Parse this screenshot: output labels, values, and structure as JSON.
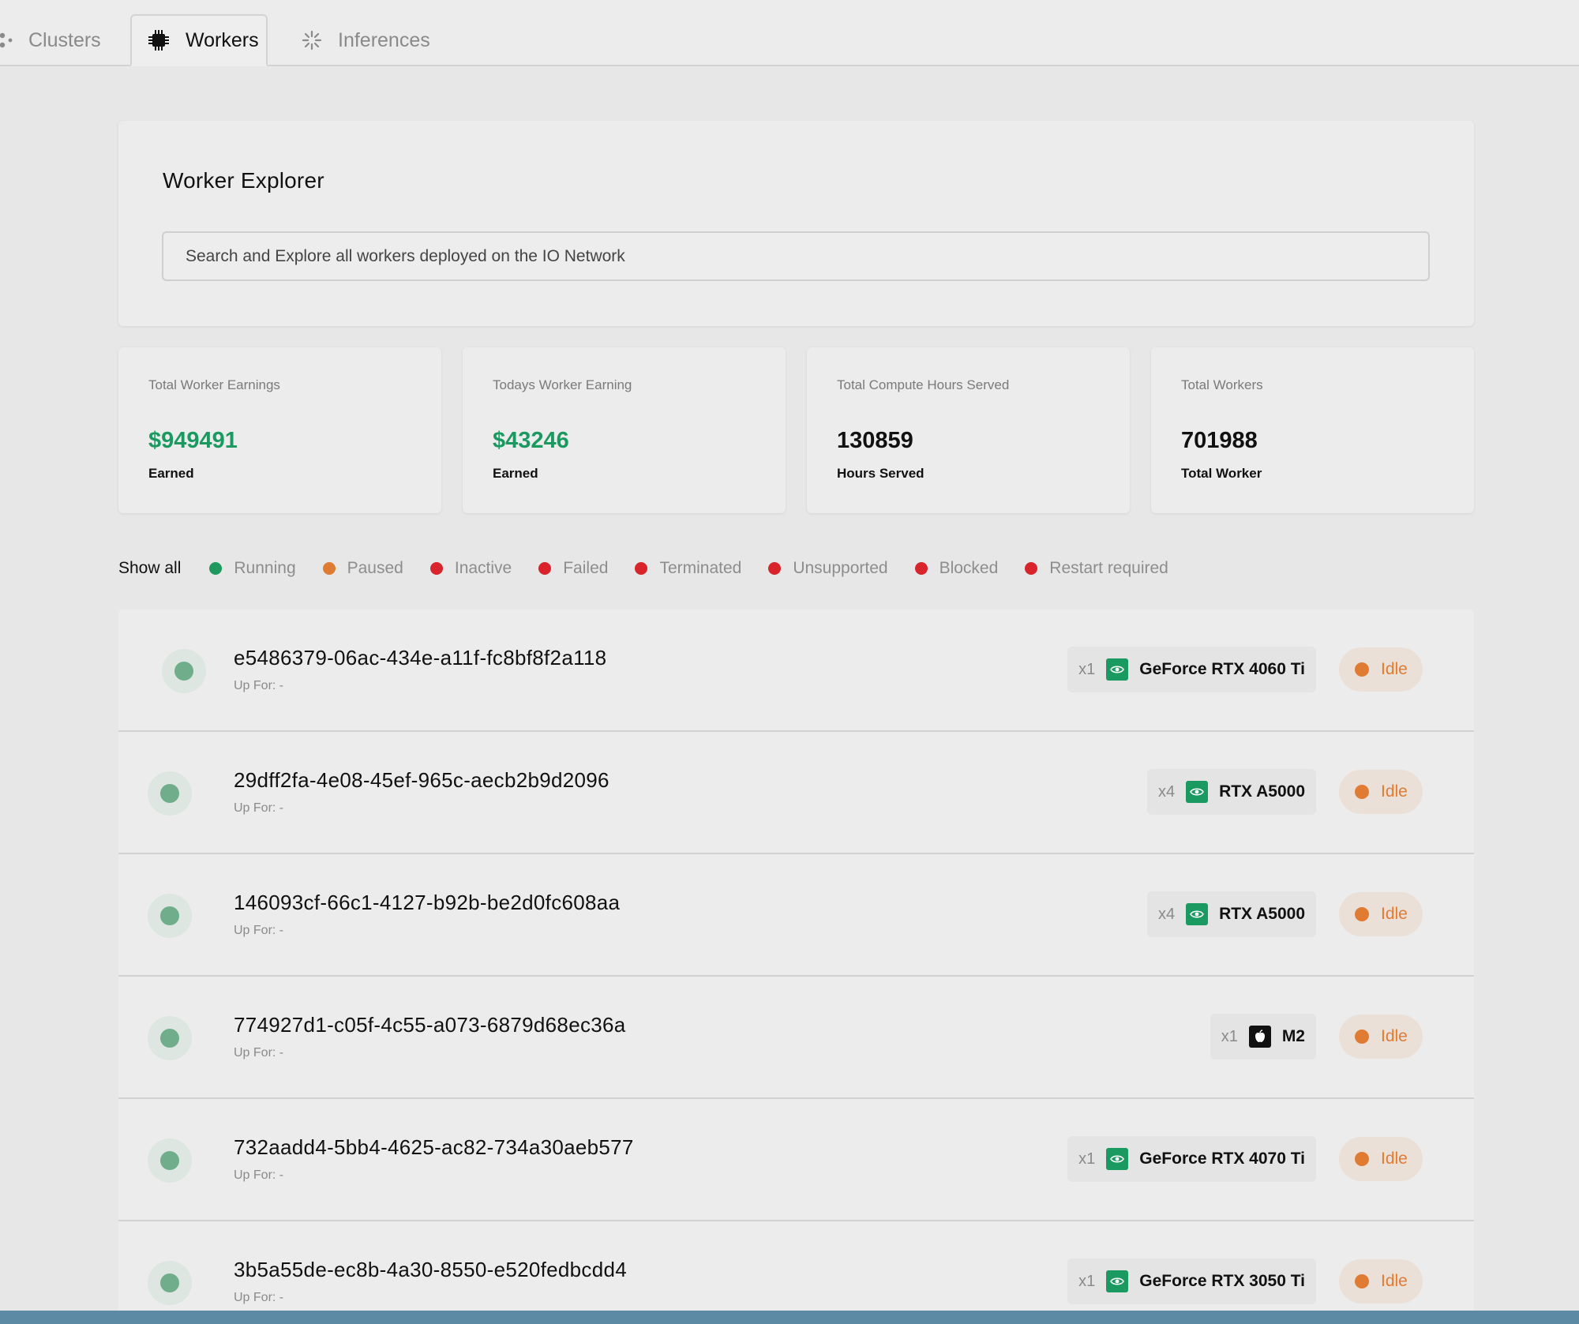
{
  "tabs": [
    {
      "label": "Clusters",
      "icon": "clusters-icon",
      "active": false
    },
    {
      "label": "Workers",
      "icon": "chip-icon",
      "active": true
    },
    {
      "label": "Inferences",
      "icon": "sparkle-icon",
      "active": false
    }
  ],
  "explorer": {
    "title": "Worker Explorer",
    "search_placeholder": "Search and Explore all workers deployed on the IO Network"
  },
  "stats": [
    {
      "label": "Total Worker Earnings",
      "value": "$949491",
      "sub": "Earned",
      "accent": "#1a9960"
    },
    {
      "label": "Todays Worker Earning",
      "value": "$43246",
      "sub": "Earned",
      "accent": "#1a9960"
    },
    {
      "label": "Total Compute Hours Served",
      "value": "130859",
      "sub": "Hours Served"
    },
    {
      "label": "Total Workers",
      "value": "701988",
      "sub": "Total Worker"
    }
  ],
  "filters": {
    "show_all": "Show all",
    "items": [
      {
        "label": "Running",
        "color": "#1f9a5e"
      },
      {
        "label": "Paused",
        "color": "#e07b33"
      },
      {
        "label": "Inactive",
        "color": "#d9242b"
      },
      {
        "label": "Failed",
        "color": "#d9242b"
      },
      {
        "label": "Terminated",
        "color": "#d9242b"
      },
      {
        "label": "Unsupported",
        "color": "#d9242b"
      },
      {
        "label": "Blocked",
        "color": "#d9242b"
      },
      {
        "label": "Restart required",
        "color": "#d9242b"
      }
    ]
  },
  "workers": [
    {
      "id": "e5486379-06ac-434e-a11f-fc8bf8f2a118",
      "uptime": "Up For: -",
      "count": "x1",
      "brand": "nvidia",
      "gpu": "GeForce RTX 4060 Ti",
      "status": "Idle"
    },
    {
      "id": "29dff2fa-4e08-45ef-965c-aecb2b9d2096",
      "uptime": "Up For: -",
      "count": "x4",
      "brand": "nvidia",
      "gpu": "RTX A5000",
      "status": "Idle"
    },
    {
      "id": "146093cf-66c1-4127-b92b-be2d0fc608aa",
      "uptime": "Up For: -",
      "count": "x4",
      "brand": "nvidia",
      "gpu": "RTX A5000",
      "status": "Idle"
    },
    {
      "id": "774927d1-c05f-4c55-a073-6879d68ec36a",
      "uptime": "Up For: -",
      "count": "x1",
      "brand": "apple",
      "gpu": "M2",
      "status": "Idle"
    },
    {
      "id": "732aadd4-5bb4-4625-ac82-734a30aeb577",
      "uptime": "Up For: -",
      "count": "x1",
      "brand": "nvidia",
      "gpu": "GeForce RTX 4070 Ti",
      "status": "Idle"
    },
    {
      "id": "3b5a55de-ec8b-4a30-8550-e520fedbcdd4",
      "uptime": "Up For: -",
      "count": "x1",
      "brand": "nvidia",
      "gpu": "GeForce RTX 3050 Ti",
      "status": "Idle"
    }
  ]
}
